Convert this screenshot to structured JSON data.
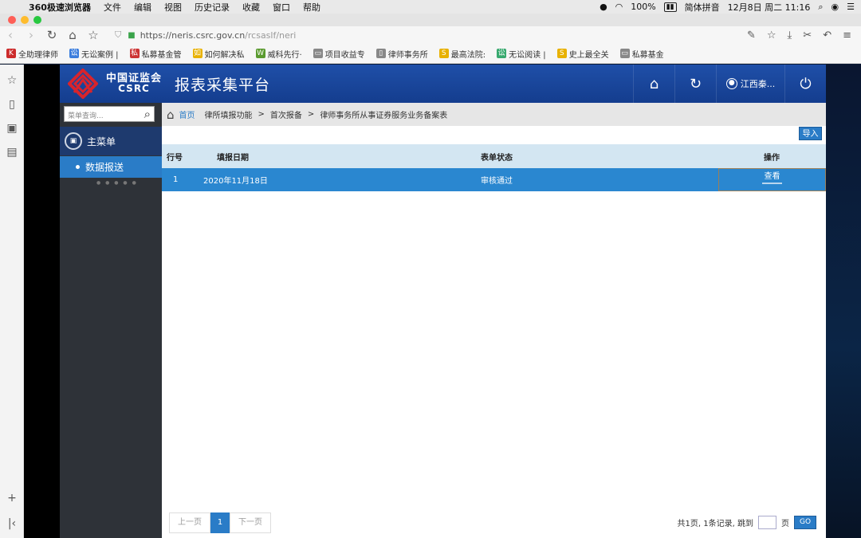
{
  "mac_menu": {
    "app_name": "360极速浏览器",
    "items": [
      "文件",
      "编辑",
      "视图",
      "历史记录",
      "收藏",
      "窗口",
      "帮助"
    ],
    "battery": "100%",
    "input_method": "简体拼音",
    "datetime": "12月8日 周二 11:16"
  },
  "browser": {
    "url_host": "https://neris.csrc.gov.cn",
    "url_path": "/rcsaslf/neri",
    "bookmarks": [
      {
        "label": "全助理律师",
        "color": "#cc2b2b",
        "glyph": "K"
      },
      {
        "label": "无讼案例 |",
        "color": "#3b7ddd",
        "glyph": "讼"
      },
      {
        "label": "私募基金管",
        "color": "#c33",
        "glyph": "私"
      },
      {
        "label": "如何解决私",
        "color": "#e8b100",
        "glyph": "如"
      },
      {
        "label": "威科先行·",
        "color": "#5a9a2f",
        "glyph": "W"
      },
      {
        "label": "项目收益专",
        "color": "#888",
        "glyph": "▭"
      },
      {
        "label": "律师事务所",
        "color": "#888",
        "glyph": "▯"
      },
      {
        "label": "最高法院:",
        "color": "#e8b100",
        "glyph": "S"
      },
      {
        "label": "无讼阅读 |",
        "color": "#37a96e",
        "glyph": "讼"
      },
      {
        "label": "史上最全关",
        "color": "#e8b100",
        "glyph": "S"
      },
      {
        "label": "私募基金",
        "color": "#888",
        "glyph": "▭"
      }
    ]
  },
  "header": {
    "logo_cn": "中国证监会",
    "logo_en": "CSRC",
    "title": "报表采集平台",
    "user": "江西秦..."
  },
  "menu": {
    "search_placeholder": "菜单查询...",
    "main_label": "主菜单",
    "sub_item": "数据报送"
  },
  "breadcrumb": {
    "home": "首页",
    "items": [
      "律所填报功能",
      "首次报备",
      "律师事务所从事证券服务业务备案表"
    ],
    "sep": ">"
  },
  "toolbar": {
    "import_label": "导入"
  },
  "table": {
    "columns": [
      "行号",
      "填报日期",
      "表单状态",
      "操作"
    ],
    "rows": [
      {
        "row_no": "1",
        "date": "2020年11月18日",
        "status": "审核通过",
        "action": "查看"
      }
    ]
  },
  "pager": {
    "prev": "上一页",
    "current": "1",
    "next": "下一页",
    "summary": "共1页, 1条记录, 跳到",
    "page_unit": "页",
    "go": "GO"
  }
}
